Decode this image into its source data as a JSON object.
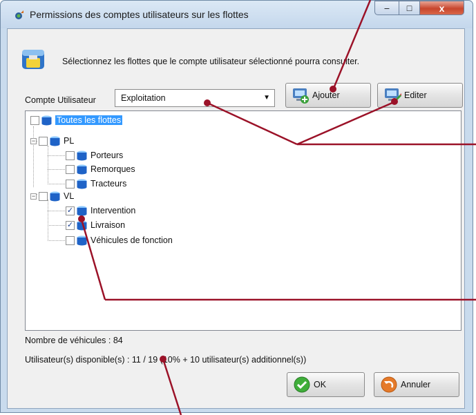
{
  "window": {
    "title": "Permissions des comptes utilisateurs sur les flottes",
    "controls": {
      "minimize": "–",
      "maximize": "□",
      "close": "x"
    }
  },
  "header": {
    "instruction": "Sélectionnez les flottes que le compte utilisateur sélectionné pourra consulter."
  },
  "account": {
    "label": "Compte Utilisateur",
    "selected": "Exploitation",
    "add_label": "Ajouter",
    "edit_label": "Editer"
  },
  "tree": {
    "root": {
      "label": "Toutes les flottes",
      "checked": false
    },
    "groups": [
      {
        "label": "PL",
        "expanded": true,
        "children": [
          {
            "label": "Porteurs",
            "checked": false
          },
          {
            "label": "Remorques",
            "checked": false
          },
          {
            "label": "Tracteurs",
            "checked": false
          }
        ]
      },
      {
        "label": "VL",
        "expanded": true,
        "children": [
          {
            "label": "Intervention",
            "checked": true
          },
          {
            "label": "Livraison",
            "checked": true
          },
          {
            "label": "Véhicules de fonction",
            "checked": false
          }
        ]
      }
    ]
  },
  "status": {
    "vehicles": "Nombre de véhicules : 84",
    "users": "Utilisateur(s) disponible(s) : 11 / 19 (10% + 10 utilisateur(s) additionnel(s))"
  },
  "footer": {
    "ok_label": "OK",
    "cancel_label": "Annuler"
  },
  "colors": {
    "annotation": "#9b1228",
    "selection": "#3399ff",
    "window_frame": "#c9dbed"
  }
}
